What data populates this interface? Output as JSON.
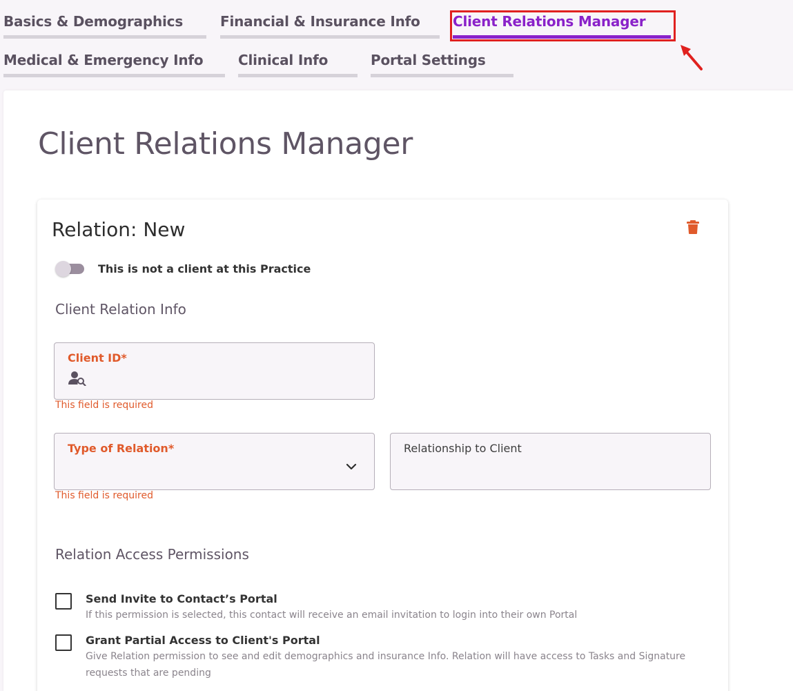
{
  "tabs": [
    {
      "label": "Basics & Demographics"
    },
    {
      "label": "Financial & Insurance Info"
    },
    {
      "label": "Client Relations Manager"
    },
    {
      "label": "Medical & Emergency Info"
    },
    {
      "label": "Clinical Info"
    },
    {
      "label": "Portal Settings"
    }
  ],
  "active_tab": "Client Relations Manager",
  "page": {
    "title": "Client Relations Manager"
  },
  "card": {
    "title": "Relation: New",
    "toggle_label": "This is not a client at this Practice",
    "toggle_on": false,
    "section_info": "Client Relation Info",
    "client_id": {
      "label": "Client ID*",
      "value": "",
      "error": "This field is required",
      "icon": "person-search-icon"
    },
    "type_of_relation": {
      "label": "Type of Relation*",
      "value": "",
      "error": "This field is required"
    },
    "relationship_to_client": {
      "label": "Relationship to Client",
      "value": ""
    },
    "section_permissions": "Relation Access Permissions",
    "permissions": [
      {
        "title": "Send Invite to Contact’s Portal",
        "description": "If this permission is selected, this contact will receive an email invitation to login into their own Portal",
        "checked": false
      },
      {
        "title": "Grant Partial Access to Client's Portal",
        "description": "Give Relation permission to see and edit demographics and insurance Info. Relation will have access to Tasks and Signature requests that are pending",
        "checked": false
      }
    ]
  },
  "colors": {
    "accent": "#8a22c9",
    "error": "#e05a2b",
    "highlight": "#e0211f"
  }
}
